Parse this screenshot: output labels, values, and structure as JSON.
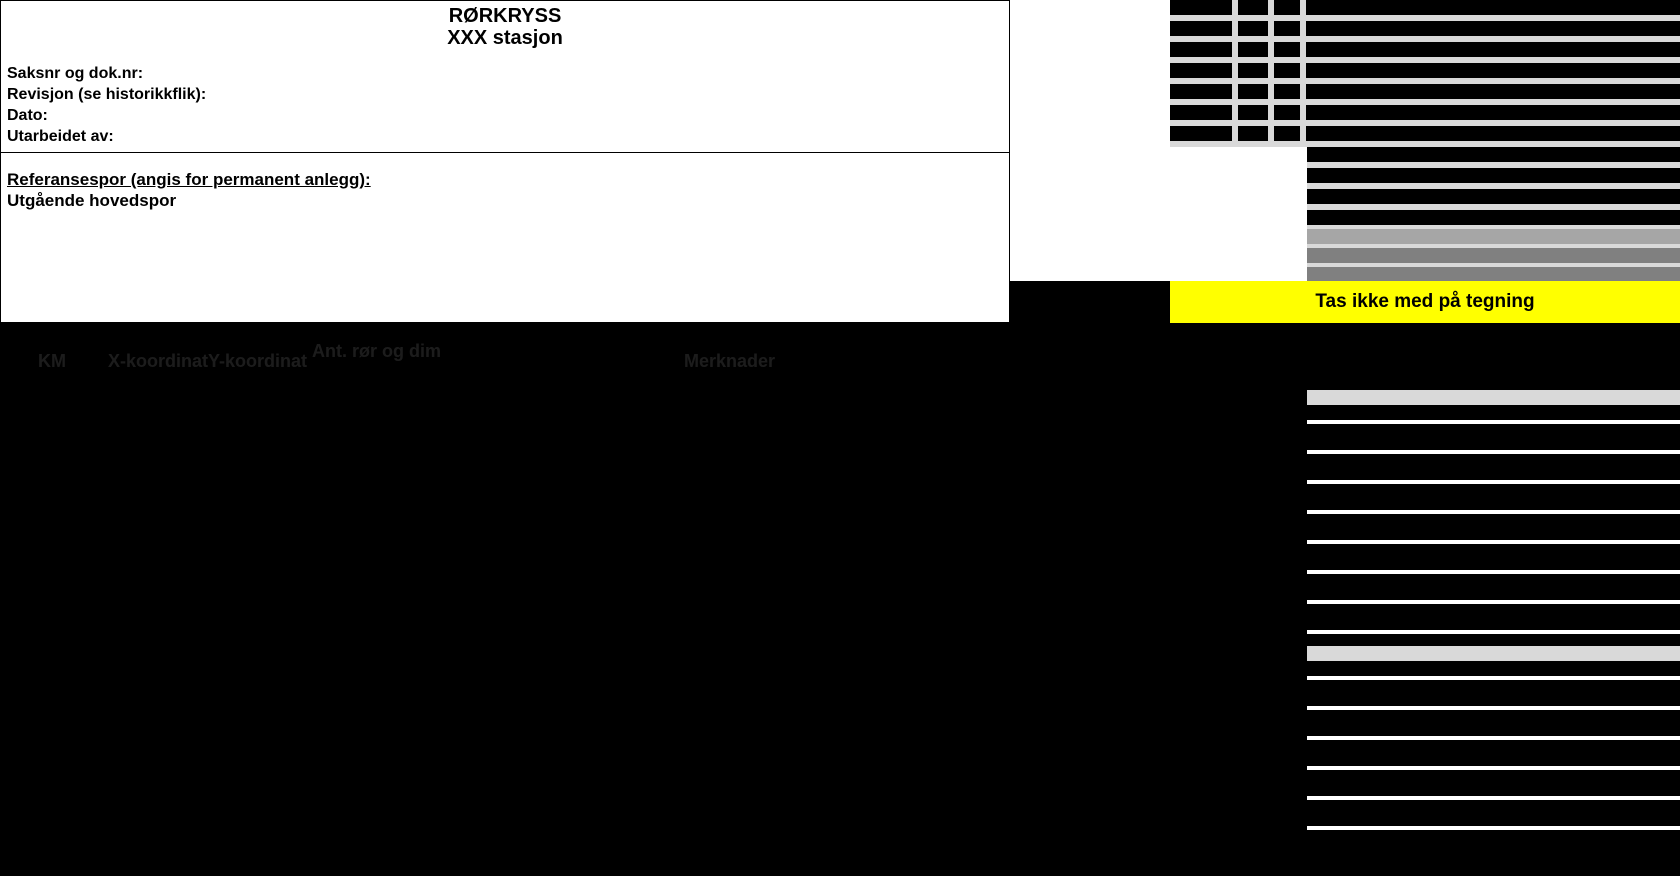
{
  "header": {
    "title1": "RØRKRYSS",
    "title2": "XXX stasjon",
    "label_saksnr": "Saksnr og dok.nr:",
    "label_revisjon": "Revisjon (se historikkflik):",
    "label_dato": "Dato:",
    "label_utarbeidet": "Utarbeidet av:"
  },
  "ref": {
    "heading": "Referansespor (angis for permanent anlegg):",
    "value": "Utgående hovedspor"
  },
  "yellow": {
    "text": "Tas ikke med på tegning"
  },
  "columns": {
    "c1": "KM",
    "c2": "X-koordinat",
    "c3": "Y-koordinat",
    "c4": "Ant. rør og dim",
    "c5": "Merknader"
  }
}
